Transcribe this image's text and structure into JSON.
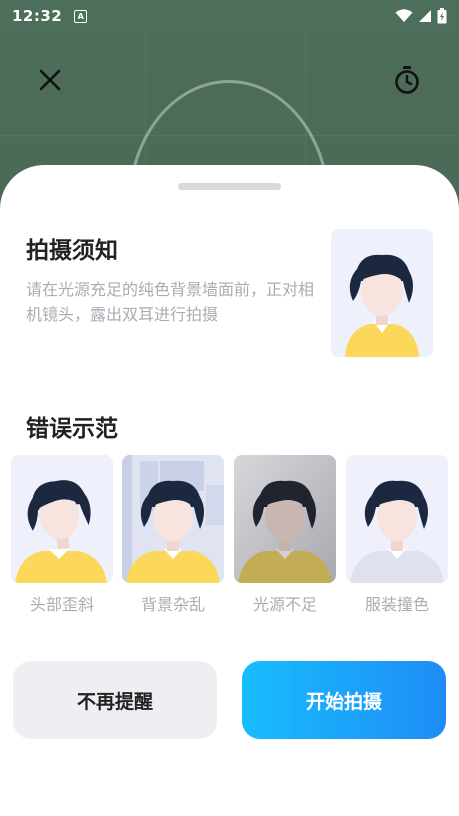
{
  "status_bar": {
    "time": "12:32",
    "notification_icon": "a-icon",
    "icons": [
      "wifi-icon",
      "signal-icon",
      "battery-charging-icon"
    ]
  },
  "top_bar": {
    "close_icon": "close-icon",
    "timer_icon": "timer-icon"
  },
  "notice": {
    "title": "拍摄须知",
    "description": "请在光源充足的纯色背景墙面前，正对相机镜头，露出双耳进行拍摄"
  },
  "wrong_examples": {
    "title": "错误示范",
    "items": [
      {
        "label": "头部歪斜"
      },
      {
        "label": "背景杂乱"
      },
      {
        "label": "光源不足"
      },
      {
        "label": "服装撞色"
      }
    ]
  },
  "buttons": {
    "dismiss": "不再提醒",
    "start": "开始拍摄"
  },
  "colors": {
    "accent_start": "#17bdfd",
    "accent_end": "#1f8cf6",
    "hair": "#1c2740",
    "shirt_yellow": "#fbd85a",
    "skin": "#f8e4de"
  }
}
